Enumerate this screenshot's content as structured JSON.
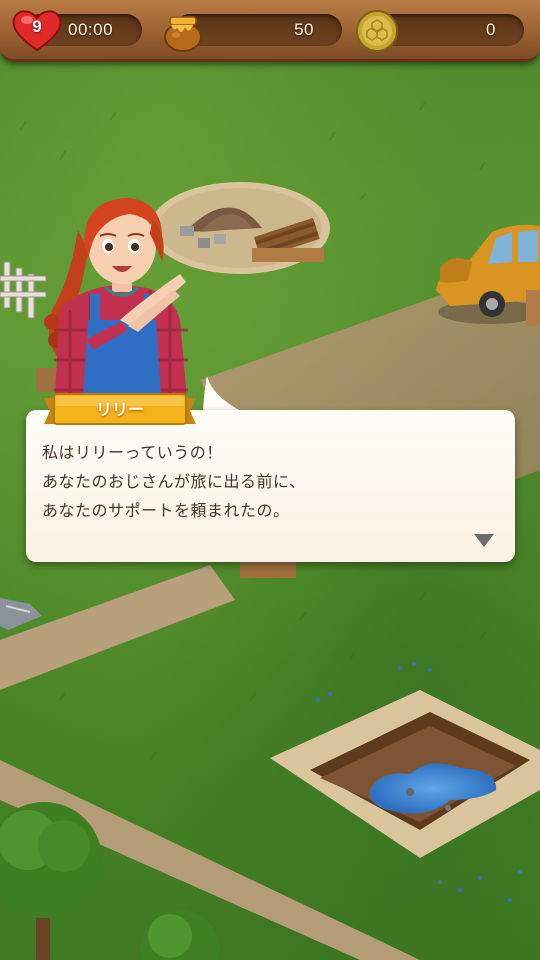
{
  "hud": {
    "lives": "9",
    "timer": "00:00",
    "honey": "50",
    "coins": "0"
  },
  "icons": {
    "lives": "heart-icon",
    "honey": "honey-pot-icon",
    "coins": "honeycomb-coin-icon",
    "next": "triangle-down-icon"
  },
  "dialog": {
    "speaker": "リリー",
    "lines": [
      "私はリリーっていうの！",
      "あなたのおじさんが旅に出る前に、",
      "あなたのサポートを頼まれたの。"
    ]
  },
  "colors": {
    "hud_wood": "#9c6233",
    "nameplate": "#f2b21a",
    "dialog_bg": "#fffdf8",
    "dialog_text": "#4a3322"
  }
}
